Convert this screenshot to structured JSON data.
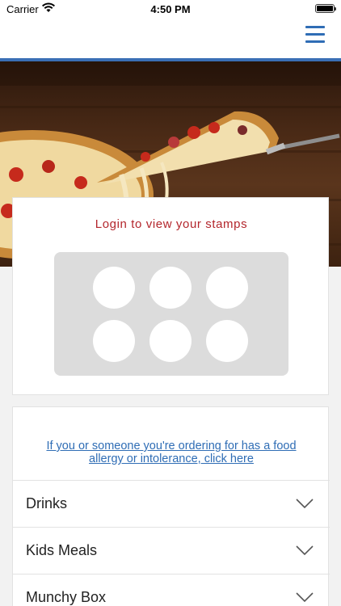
{
  "status_bar": {
    "carrier": "Carrier",
    "time": "4:50 PM"
  },
  "header": {
    "menu_icon": "hamburger-menu-icon",
    "accent_color": "#2f6db5"
  },
  "hero": {
    "image": "pizza-slice-photo"
  },
  "stamps": {
    "title": "Login to view your stamps",
    "title_color": "#b3262c",
    "total": 6,
    "filled": 0
  },
  "allergy": {
    "link_text_line1": "If you or someone you're ordering for has a food",
    "link_text_line2": "allergy or intolerance, click here"
  },
  "menu": {
    "items": [
      {
        "label": "Drinks"
      },
      {
        "label": "Kids Meals"
      },
      {
        "label": "Munchy Box"
      }
    ]
  }
}
